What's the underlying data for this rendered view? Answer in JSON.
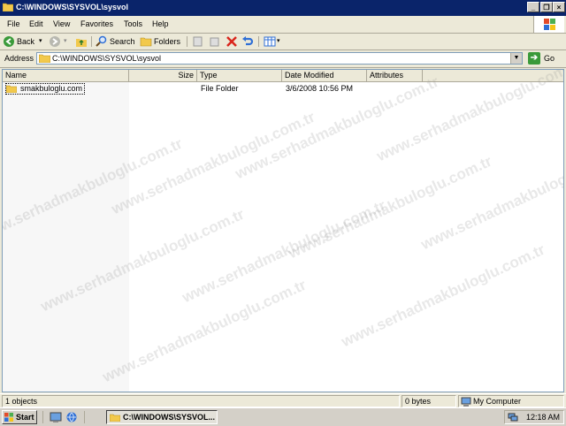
{
  "window": {
    "title": "C:\\WINDOWS\\SYSVOL\\sysvol",
    "controls": {
      "minimize": "_",
      "maximize": "❐",
      "close": "×"
    }
  },
  "menu": [
    "File",
    "Edit",
    "View",
    "Favorites",
    "Tools",
    "Help"
  ],
  "toolbar": {
    "back_label": "Back",
    "search_label": "Search",
    "folders_label": "Folders"
  },
  "address": {
    "label": "Address",
    "value": "C:\\WINDOWS\\SYSVOL\\sysvol",
    "go_label": "Go"
  },
  "columns": [
    "Name",
    "Size",
    "Type",
    "Date Modified",
    "Attributes"
  ],
  "rows": [
    {
      "name": "smakbuloglu.com",
      "size": "",
      "type": "File Folder",
      "date": "3/6/2008 10:56 PM",
      "attributes": ""
    }
  ],
  "status": {
    "objects": "1 objects",
    "size": "0 bytes",
    "zone": "My Computer"
  },
  "taskbar": {
    "start_label": "Start",
    "task_label": "C:\\WINDOWS\\SYSVOL...",
    "clock": "12:18 AM"
  },
  "watermark": "www.serhadmakbuloglu.com.tr",
  "colors": {
    "titlebar": "#0a246a",
    "folder": "#f2c94c",
    "face": "#ece9d8"
  }
}
